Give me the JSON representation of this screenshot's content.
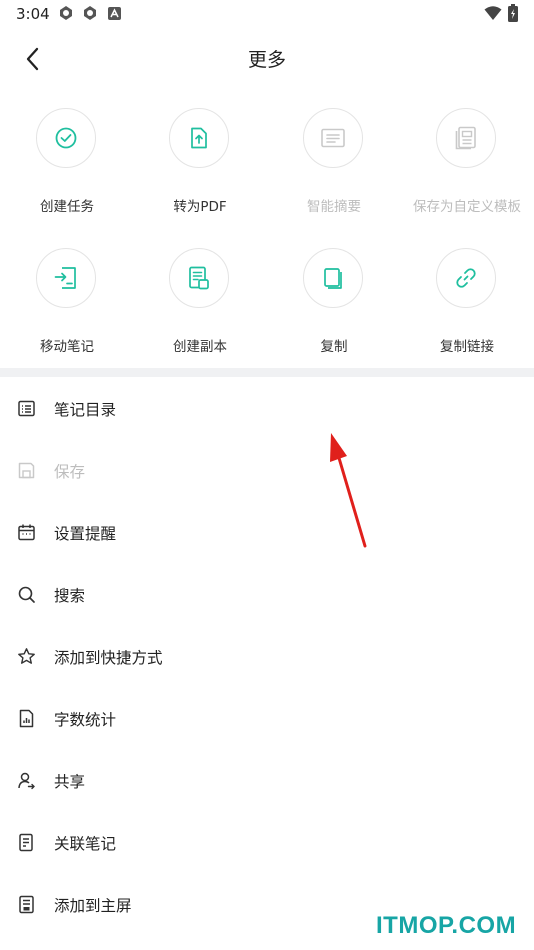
{
  "status_bar": {
    "time": "3:04"
  },
  "header": {
    "title": "更多"
  },
  "grid": [
    {
      "label": "创建任务",
      "icon": "create-task-icon",
      "enabled": true
    },
    {
      "label": "转为PDF",
      "icon": "convert-pdf-icon",
      "enabled": true
    },
    {
      "label": "智能摘要",
      "icon": "smart-summary-icon",
      "enabled": false
    },
    {
      "label": "保存为自定义模板",
      "icon": "save-template-icon",
      "enabled": false
    },
    {
      "label": "移动笔记",
      "icon": "move-note-icon",
      "enabled": true
    },
    {
      "label": "创建副本",
      "icon": "create-copy-icon",
      "enabled": true
    },
    {
      "label": "复制",
      "icon": "copy-icon",
      "enabled": true
    },
    {
      "label": "复制链接",
      "icon": "copy-link-icon",
      "enabled": true
    }
  ],
  "menu": [
    {
      "label": "笔记目录",
      "icon": "toc-icon",
      "enabled": true
    },
    {
      "label": "保存",
      "icon": "save-icon",
      "enabled": false
    },
    {
      "label": "设置提醒",
      "icon": "calendar-icon",
      "enabled": true
    },
    {
      "label": "搜索",
      "icon": "search-icon",
      "enabled": true
    },
    {
      "label": "添加到快捷方式",
      "icon": "star-icon",
      "enabled": true
    },
    {
      "label": "字数统计",
      "icon": "word-count-icon",
      "enabled": true
    },
    {
      "label": "共享",
      "icon": "share-user-icon",
      "enabled": true
    },
    {
      "label": "关联笔记",
      "icon": "linked-note-icon",
      "enabled": true
    },
    {
      "label": "添加到主屏",
      "icon": "home-screen-icon",
      "enabled": true
    }
  ],
  "colors": {
    "accent": "#1fbf9f",
    "disabled": "#bdbdbd",
    "annotation_arrow": "#e0201c",
    "watermark": "#17a5a5"
  },
  "watermark": "ITMOP.COM"
}
